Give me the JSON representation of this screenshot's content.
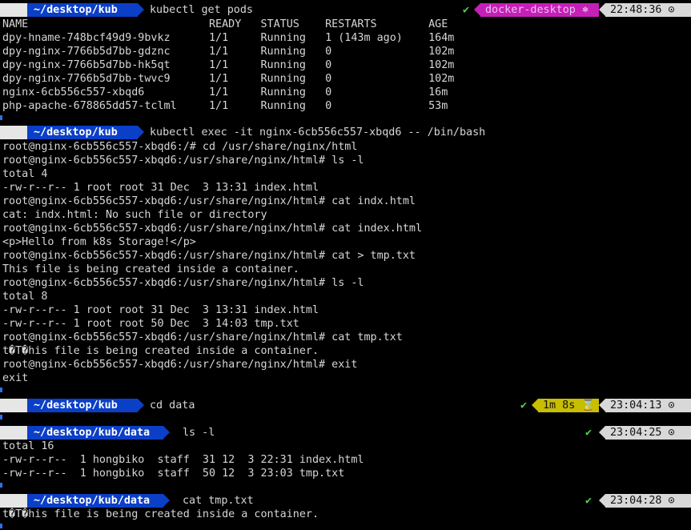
{
  "colors": {
    "path_bg": "#0b3fc7",
    "check": "#55d655",
    "ctx_bg": "#c61fb8",
    "dur_bg": "#c9bd00",
    "time_bg": "#d8d8d8"
  },
  "icons": {
    "apple": "apple-icon",
    "clock": "clock-icon",
    "hourglass": "hourglass-icon",
    "gear": "gear-icon"
  },
  "prompts": [
    {
      "apple": "",
      "path": "~/desktop/kub",
      "cmd": "kubectl get pods",
      "check": "✔",
      "ctx": "docker-desktop ⎈",
      "duration": "",
      "time": "22:48:36 ⊙"
    },
    {
      "apple": "",
      "path": "~/desktop/kub",
      "cmd": "kubectl exec -it nginx-6cb556c557-xbqd6 -- /bin/bash",
      "check": "",
      "ctx": "",
      "duration": "",
      "time": ""
    },
    {
      "apple": "",
      "path": "~/desktop/kub",
      "cmd": "cd data",
      "check": "✔",
      "ctx": "",
      "duration": "1m 8s ⌛",
      "time": "23:04:13 ⊙"
    },
    {
      "apple": "",
      "path": "~/desktop/kub/data",
      "cmd": "ls -l",
      "check": "✔",
      "ctx": "",
      "duration": "",
      "time": "23:04:25 ⊙"
    },
    {
      "apple": "",
      "path": "~/desktop/kub/data",
      "cmd": "cat tmp.txt",
      "check": "✔",
      "ctx": "",
      "duration": "",
      "time": "23:04:28 ⊙"
    }
  ],
  "output1": [
    "NAME                            READY   STATUS    RESTARTS        AGE",
    "dpy-hname-748bcf49d9-9bvkz      1/1     Running   1 (143m ago)    164m",
    "dpy-nginx-7766b5d7bb-gdznc      1/1     Running   0               102m",
    "dpy-nginx-7766b5d7bb-hk5qt      1/1     Running   0               102m",
    "dpy-nginx-7766b5d7bb-twvc9      1/1     Running   0               102m",
    "nginx-6cb556c557-xbqd6          1/1     Running   0               16m",
    "php-apache-678865dd57-tclml     1/1     Running   0               53m"
  ],
  "output2": [
    "root@nginx-6cb556c557-xbqd6:/# cd /usr/share/nginx/html",
    "root@nginx-6cb556c557-xbqd6:/usr/share/nginx/html# ls -l",
    "total 4",
    "-rw-r--r-- 1 root root 31 Dec  3 13:31 index.html",
    "root@nginx-6cb556c557-xbqd6:/usr/share/nginx/html# cat indx.html",
    "cat: indx.html: No such file or directory",
    "root@nginx-6cb556c557-xbqd6:/usr/share/nginx/html# cat index.html",
    "<p>Hello from k8s Storage!</p>",
    "root@nginx-6cb556c557-xbqd6:/usr/share/nginx/html# cat > tmp.txt",
    "This file is being created inside a container.",
    "root@nginx-6cb556c557-xbqd6:/usr/share/nginx/html# ls -l",
    "total 8",
    "-rw-r--r-- 1 root root 31 Dec  3 13:31 index.html",
    "-rw-r--r-- 1 root root 50 Dec  3 14:03 tmp.txt",
    "root@nginx-6cb556c557-xbqd6:/usr/share/nginx/html# cat tmp.txt",
    "t�T�his file is being created inside a container.",
    "root@nginx-6cb556c557-xbqd6:/usr/share/nginx/html# exit",
    "exit"
  ],
  "output3": [
    "total 16",
    "-rw-r--r--  1 hongbiko  staff  31 12  3 22:31 index.html",
    "-rw-r--r--  1 hongbiko  staff  50 12  3 23:03 tmp.txt"
  ],
  "output4": [
    "t�T�his file is being created inside a container."
  ]
}
